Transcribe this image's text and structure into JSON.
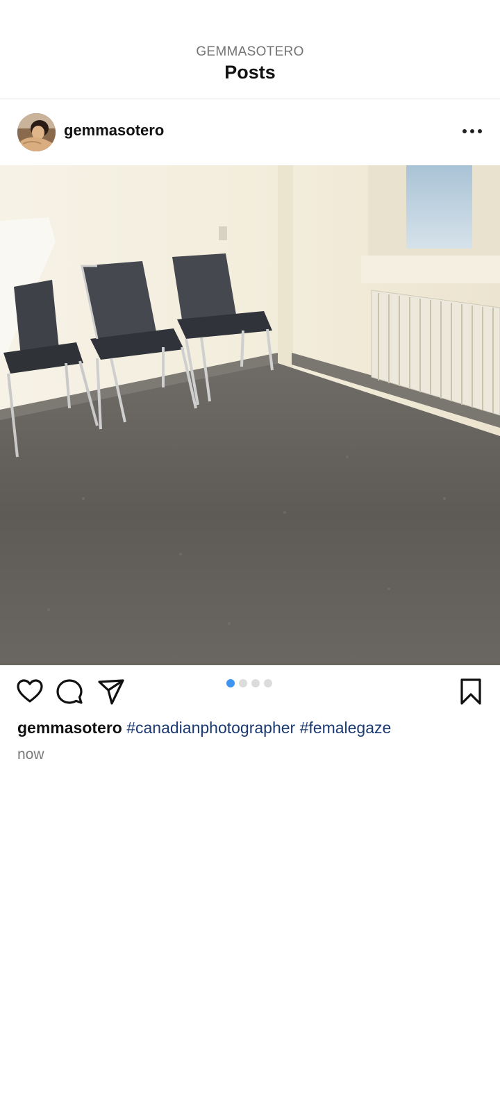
{
  "header": {
    "username": "GEMMASOTERO",
    "title": "Posts"
  },
  "post": {
    "username": "gemmasotero",
    "avatar_icon": "profile-avatar",
    "more_icon": "more-options-icon",
    "carousel": {
      "total": 4,
      "active_index": 0
    },
    "actions": {
      "like_icon": "heart-icon",
      "comment_icon": "comment-bubble-icon",
      "share_icon": "paper-plane-icon",
      "save_icon": "bookmark-icon"
    },
    "caption": {
      "username": "gemmasotero",
      "hashtags": [
        "#canadianphotographer",
        "#femalegaze"
      ]
    },
    "timestamp": "now"
  },
  "colors": {
    "accent_dot": "#3d95f0",
    "hashtag": "#1b3a72",
    "muted_text": "#737373"
  }
}
